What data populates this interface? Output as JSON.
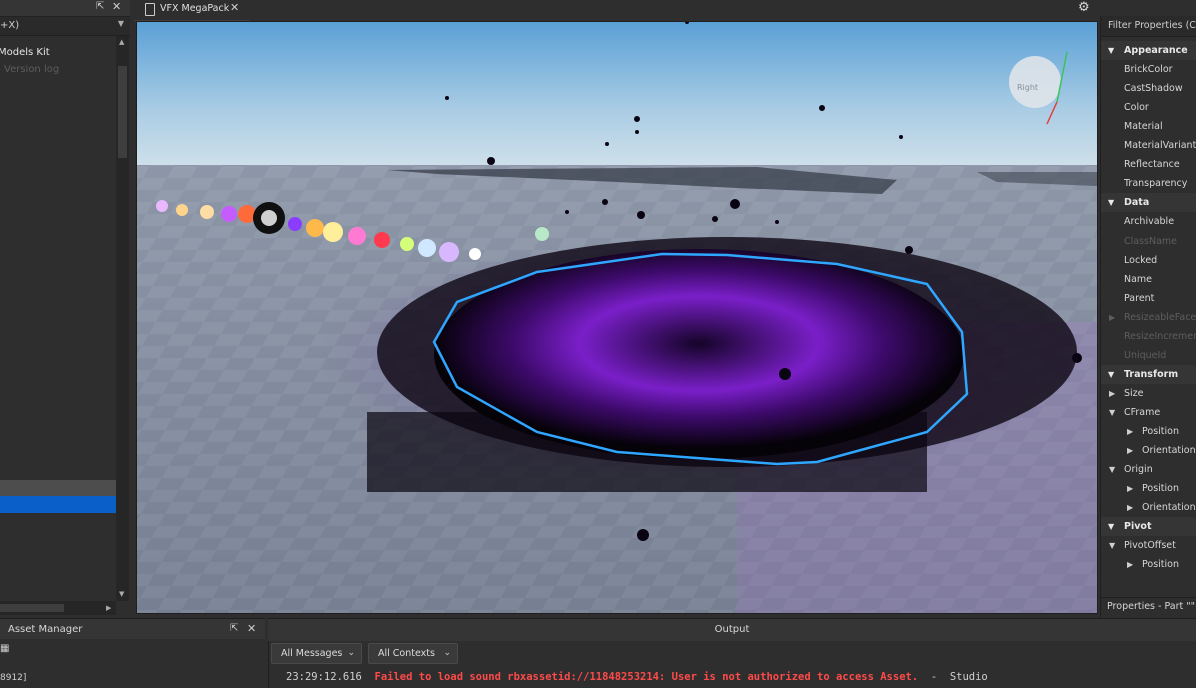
{
  "left_panel": {
    "filter_text": "+X)",
    "tree_items": [
      "Models Kit",
      "Version log"
    ],
    "asset_id_fragment": "8912]"
  },
  "editor_tab": {
    "label": "VFX MegaPack"
  },
  "viewport": {
    "view_cube_label": "Right"
  },
  "properties": {
    "filter_placeholder": "Filter Properties (Ctrl+Shift+P)",
    "footer": "Properties - Part \"\"",
    "rows": [
      {
        "type": "cat",
        "label": "Appearance"
      },
      {
        "type": "prop",
        "label": "BrickColor"
      },
      {
        "type": "prop",
        "label": "CastShadow"
      },
      {
        "type": "prop",
        "label": "Color"
      },
      {
        "type": "prop",
        "label": "Material"
      },
      {
        "type": "prop",
        "label": "MaterialVariant"
      },
      {
        "type": "prop",
        "label": "Reflectance"
      },
      {
        "type": "prop",
        "label": "Transparency"
      },
      {
        "type": "cat",
        "label": "Data"
      },
      {
        "type": "prop",
        "label": "Archivable"
      },
      {
        "type": "dim",
        "label": "ClassName"
      },
      {
        "type": "prop",
        "label": "Locked"
      },
      {
        "type": "prop",
        "label": "Name"
      },
      {
        "type": "prop",
        "label": "Parent"
      },
      {
        "type": "dimx",
        "label": "ResizeableFaces"
      },
      {
        "type": "dim",
        "label": "ResizeIncrement"
      },
      {
        "type": "dim",
        "label": "UniqueId"
      },
      {
        "type": "cat",
        "label": "Transform"
      },
      {
        "type": "exp",
        "label": "Size"
      },
      {
        "type": "open",
        "label": "CFrame"
      },
      {
        "type": "sub",
        "label": "Position"
      },
      {
        "type": "sub",
        "label": "Orientation"
      },
      {
        "type": "open",
        "label": "Origin"
      },
      {
        "type": "sub",
        "label": "Position"
      },
      {
        "type": "sub",
        "label": "Orientation"
      },
      {
        "type": "cat",
        "label": "Pivot"
      },
      {
        "type": "open",
        "label": "PivotOffset"
      },
      {
        "type": "sub",
        "label": "Position"
      }
    ]
  },
  "asset_manager": {
    "title": "Asset Manager"
  },
  "output": {
    "title": "Output",
    "filter_messages": "All Messages",
    "filter_contexts": "All Contexts",
    "log": {
      "timestamp": "23:29:12.616",
      "message": "Failed to load sound rbxassetid://11848253214: User is not authorized to access Asset.",
      "separator": "-",
      "source": "Studio"
    }
  },
  "colors": {
    "selection_blue": "#0b5fc9",
    "error_red": "#ff4a4a",
    "selection_outline": "#2fa6ff",
    "vfx_purple": "#7a1fc9"
  }
}
